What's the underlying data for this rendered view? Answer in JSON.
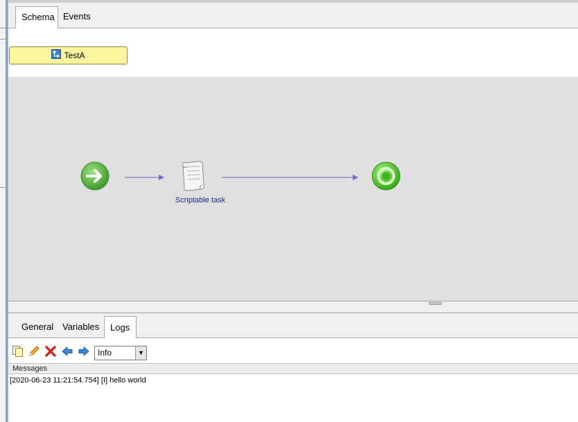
{
  "top_tabs": [
    {
      "label": "Schema",
      "active": true
    },
    {
      "label": "Events",
      "active": false
    }
  ],
  "process": {
    "name": "TestA",
    "icon": "process-icon"
  },
  "canvas": {
    "nodes": {
      "start": {
        "icon": "start-event-icon",
        "color": "#5fb74a"
      },
      "task": {
        "label": "Scriptable task",
        "icon": "scroll-icon"
      },
      "end": {
        "icon": "end-event-icon",
        "color": "#4ec22a"
      }
    },
    "edge_color": "#6b6bd6"
  },
  "bottom_tabs": [
    {
      "label": "General",
      "active": false
    },
    {
      "label": "Variables",
      "active": false
    },
    {
      "label": "Logs",
      "active": true
    }
  ],
  "toolbar": {
    "icons": [
      "copy-icon",
      "edit-icon",
      "delete-icon",
      "back-arrow-icon",
      "forward-arrow-icon"
    ],
    "level_select": {
      "value": "Info"
    }
  },
  "messages": {
    "header": "Messages",
    "lines": [
      "[2020-06-23 11:21:54.754] [I] hello world"
    ]
  }
}
